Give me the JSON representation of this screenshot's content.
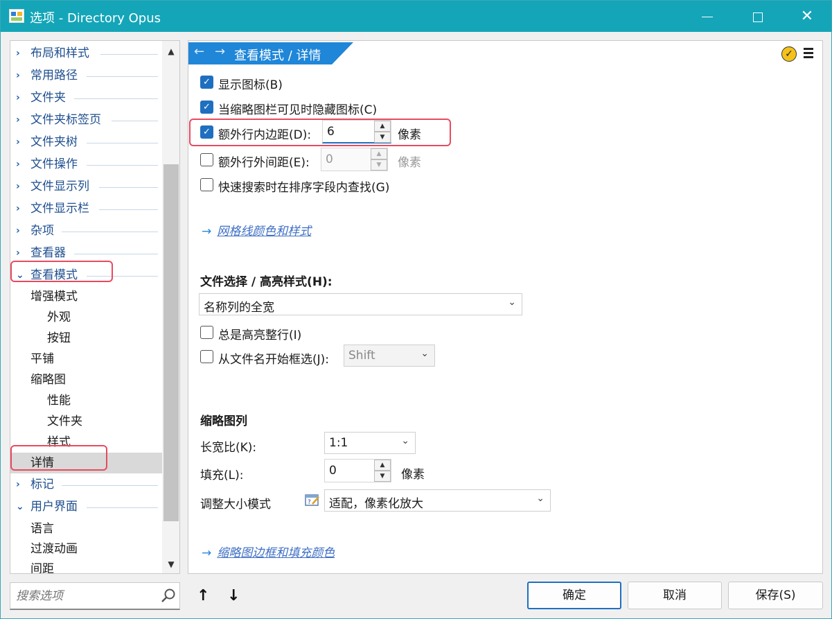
{
  "window": {
    "title": "选项 - Directory Opus",
    "close_glyph": "✕"
  },
  "tree": {
    "items": [
      {
        "label": "布局和样式",
        "expander": "›"
      },
      {
        "label": "常用路径",
        "expander": "›"
      },
      {
        "label": "文件夹",
        "expander": "›"
      },
      {
        "label": "文件夹标签页",
        "expander": "›"
      },
      {
        "label": "文件夹树",
        "expander": "›"
      },
      {
        "label": "文件操作",
        "expander": "›"
      },
      {
        "label": "文件显示列",
        "expander": "›"
      },
      {
        "label": "文件显示栏",
        "expander": "›"
      },
      {
        "label": "杂项",
        "expander": "›"
      },
      {
        "label": "查看器",
        "expander": "›"
      },
      {
        "label": "查看模式",
        "expander": "⌄"
      },
      {
        "label": "增强模式"
      },
      {
        "label": "外观"
      },
      {
        "label": "按钮"
      },
      {
        "label": "平铺"
      },
      {
        "label": "缩略图"
      },
      {
        "label": "性能"
      },
      {
        "label": "文件夹"
      },
      {
        "label": "样式"
      },
      {
        "label": "详情"
      },
      {
        "label": "标记",
        "expander": "›"
      },
      {
        "label": "用户界面",
        "expander": "⌄"
      },
      {
        "label": "语言"
      },
      {
        "label": "过渡动画"
      },
      {
        "label": "间距"
      }
    ],
    "scroll_up": "▲",
    "scroll_down": "▼"
  },
  "search": {
    "placeholder": "搜索选项"
  },
  "content": {
    "breadcrumb": "查看模式 / 详情",
    "nav_back": "←",
    "nav_forward": "→",
    "apply_glyph": "✓",
    "show_icons": "显示图标(B)",
    "hide_icons_thumb": "当缩略图栏可见时隐藏图标(C)",
    "extra_padding": {
      "label": "额外行内边距(D):",
      "value": "6",
      "unit": "像素"
    },
    "extra_spacing": {
      "label": "额外行外间距(E):",
      "value": "0",
      "unit": "像素"
    },
    "quick_search": "快速搜索时在排序字段内查找(G)",
    "link_grid": "网格线颜色和样式",
    "link_arrow": "→",
    "selection_section": "文件选择 / 高亮样式(H):",
    "selection_value": "名称列的全宽",
    "always_highlight": "总是高亮整行(I)",
    "lasso_from_name": "从文件名开始框选(J):",
    "lasso_key": "Shift",
    "thumb_section": "缩略图列",
    "aspect_label": "长宽比(K):",
    "aspect_value": "1:1",
    "fill_label": "填充(L):",
    "fill_value": "0",
    "fill_unit": "像素",
    "resize_label": "调整大小模式",
    "resize_value": "适配，像素化放大",
    "link_thumb_border": "缩略图边框和填充颜色",
    "chevron": "⌄",
    "spin_up": "▲",
    "spin_down": "▼",
    "check_glyph": "✓"
  },
  "footer": {
    "move_up": "↑",
    "move_down": "↓",
    "ok": "确定",
    "cancel": "取消",
    "save": "保存(S)"
  },
  "colors": {
    "titlebar": "#14a5b8",
    "accent": "#1f6fc0",
    "breadcrumb": "#1f86d8",
    "highlight_box": "#e84a5f"
  }
}
